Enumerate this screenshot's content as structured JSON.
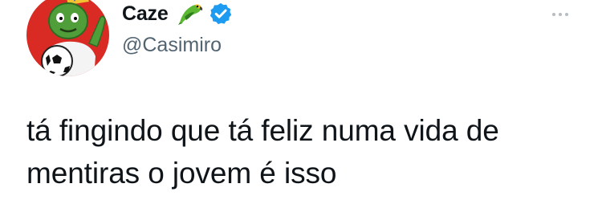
{
  "tweet": {
    "author": {
      "display_name": "Caze",
      "handle": "@Casimiro",
      "name_emoji": "parrot-emoji",
      "verified_badge": "verified-icon"
    },
    "text": "tá fingindo que tá feliz numa vida de mentiras o jovem é isso",
    "more_menu_icon": "more-icon"
  },
  "colors": {
    "avatar_bg": "#d92a24",
    "avatar_figure": "#4f9e3a",
    "verified_blue": "#1d9bf0",
    "handle_gray": "#536471",
    "text": "#0f1419"
  }
}
